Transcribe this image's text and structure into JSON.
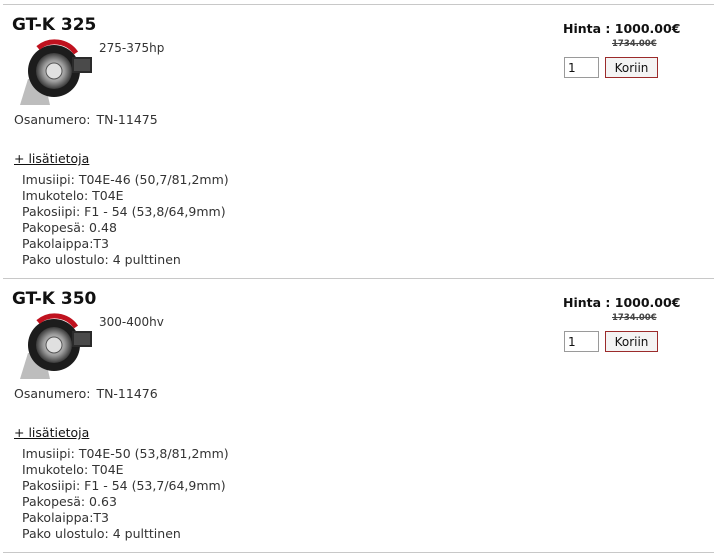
{
  "products": [
    {
      "name": "GT-K 325",
      "power": "275-375hp",
      "part_number_label": "Osanumero:",
      "part_number": "TN-11475",
      "more_info_label": "+ lisätietoja",
      "specs": [
        "Imusiipi: T04E-46 (50,7/81,2mm)",
        "Imukotelo: T04E",
        "Pakosiipi: F1 - 54 (53,8/64,9mm)",
        "Pakopesä: 0.48",
        "Pakolaippa:T3",
        "Pako ulostulo: 4 pulttinen"
      ],
      "price_text": "Hinta : 1000.00€",
      "old_price": "1734.00€",
      "quantity": "1",
      "cart_button": "Koriin"
    },
    {
      "name": "GT-K 350",
      "power": "300-400hv",
      "part_number_label": "Osanumero:",
      "part_number": "TN-11476",
      "more_info_label": "+ lisätietoja",
      "specs": [
        "Imusiipi: T04E-50 (53,8/81,2mm)",
        "Imukotelo: T04E",
        "Pakosiipi: F1 - 54 (53,7/64,9mm)",
        "Pakopesä: 0.63",
        "Pakolaippa:T3",
        "Pako ulostulo: 4 pulttinen"
      ],
      "price_text": "Hinta : 1000.00€",
      "old_price": "1734.00€",
      "quantity": "1",
      "cart_button": "Koriin"
    }
  ],
  "icons": {
    "product_image": "turbocharger-icon"
  },
  "colors": {
    "cart_border": "#9b2b2b",
    "divider": "#c8c8c8"
  }
}
